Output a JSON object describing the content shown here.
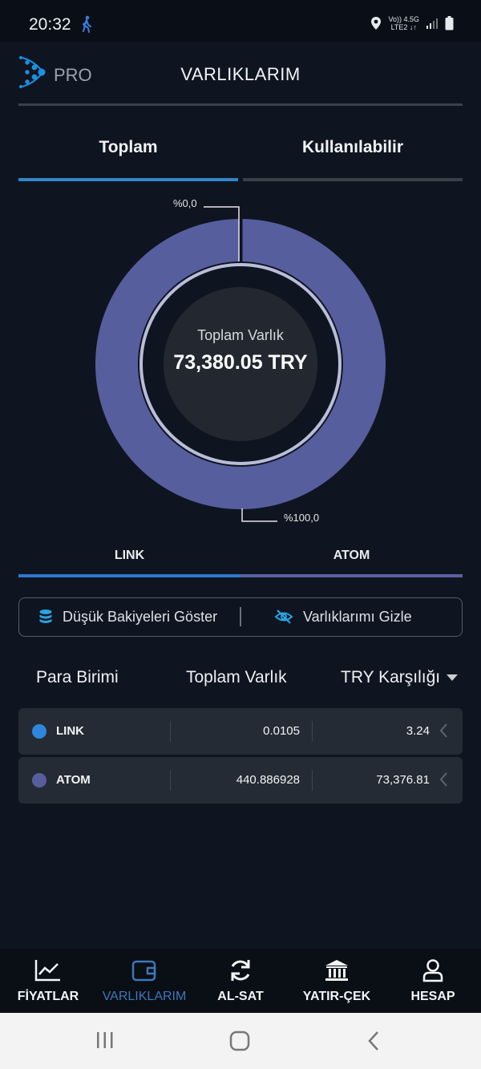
{
  "status": {
    "time": "20:32",
    "net_top": "Vo)) 4.5G",
    "net_bottom": "LTE2 ↓↑"
  },
  "header": {
    "brand": "PRO",
    "title": "VARLIKLARIM"
  },
  "tabs": [
    {
      "label": "Toplam",
      "active": true
    },
    {
      "label": "Kullanılabilir",
      "active": false
    }
  ],
  "chart_data": {
    "type": "pie",
    "categories": [
      "LINK",
      "ATOM"
    ],
    "values": [
      3.24,
      73376.81
    ],
    "labels": [
      "%0,0",
      "%100,0"
    ],
    "center_label": "Toplam Varlık",
    "center_value": "73,380.05 TRY",
    "colors": [
      "#2e86de",
      "#575e9e"
    ]
  },
  "asset_tabs": [
    {
      "label": "LINK",
      "color": "#2e86de"
    },
    {
      "label": "ATOM",
      "color": "#575e9e"
    }
  ],
  "toggles": {
    "low_balance": "Düşük Bakiyeleri Göster",
    "hide_assets": "Varlıklarımı Gizle"
  },
  "table": {
    "headers": [
      "Para Birimi",
      "Toplam Varlık",
      "TRY Karşılığı"
    ],
    "rows": [
      {
        "currency": "LINK",
        "amount": "0.0105",
        "try_value": "3.24",
        "color": "#2e86de"
      },
      {
        "currency": "ATOM",
        "amount": "440.886928",
        "try_value": "73,376.81",
        "color": "#575e9e"
      }
    ]
  },
  "nav": [
    {
      "label": "FİYATLAR",
      "icon": "chart-line-icon"
    },
    {
      "label": "VARLIKLARIM",
      "icon": "wallet-icon",
      "active": true
    },
    {
      "label": "AL-SAT",
      "icon": "refresh-icon"
    },
    {
      "label": "YATIR-ÇEK",
      "icon": "bank-icon"
    },
    {
      "label": "HESAP",
      "icon": "user-icon"
    }
  ]
}
